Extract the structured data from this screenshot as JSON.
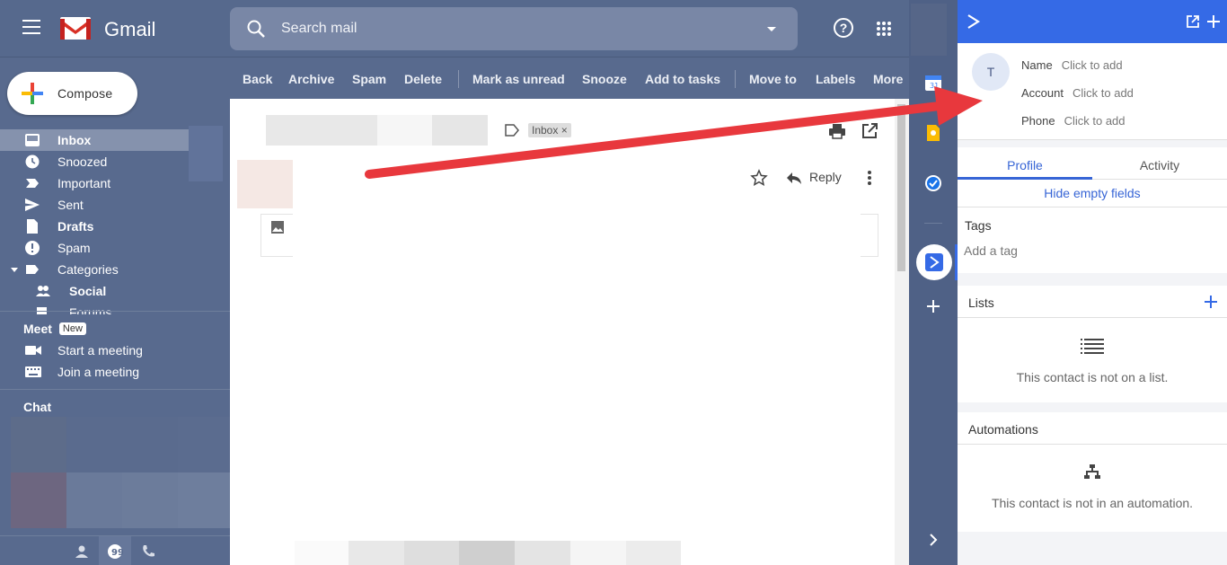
{
  "header": {
    "brand": "Gmail",
    "search_placeholder": "Search mail"
  },
  "compose": {
    "label": "Compose"
  },
  "nav": [
    {
      "label": "Inbox",
      "icon": "inbox-icon",
      "active": true,
      "bold": true
    },
    {
      "label": "Snoozed",
      "icon": "clock-icon"
    },
    {
      "label": "Important",
      "icon": "important-icon"
    },
    {
      "label": "Sent",
      "icon": "send-icon"
    },
    {
      "label": "Drafts",
      "icon": "draft-icon",
      "bold": true
    },
    {
      "label": "Spam",
      "icon": "spam-icon"
    },
    {
      "label": "Categories",
      "icon": "label-icon"
    },
    {
      "label": "Social",
      "icon": "people-icon",
      "bold": true,
      "sub": true
    },
    {
      "label": "Forums",
      "icon": "forum-icon",
      "sub": true
    }
  ],
  "meet": {
    "title": "Meet",
    "badge": "New",
    "items": [
      {
        "label": "Start a meeting",
        "icon": "video-icon"
      },
      {
        "label": "Join a meeting",
        "icon": "keyboard-icon"
      }
    ]
  },
  "chat": {
    "title": "Chat"
  },
  "toolbar": [
    "Back",
    "Archive",
    "Spam",
    "Delete",
    "Mark as unread",
    "Snooze",
    "Add to tasks",
    "Move to",
    "Labels",
    "More"
  ],
  "email": {
    "label_tag": "Inbox",
    "reply_label": "Reply"
  },
  "contact_panel": {
    "avatar_initial": "T",
    "fields": [
      {
        "key": "Name",
        "value": "Click to add"
      },
      {
        "key": "Account",
        "value": "Click to add"
      },
      {
        "key": "Phone",
        "value": "Click to add"
      }
    ],
    "tabs": [
      "Profile",
      "Activity"
    ],
    "active_tab": "Profile",
    "hide_empty": "Hide empty fields",
    "tags_title": "Tags",
    "tags_placeholder": "Add a tag",
    "lists_title": "Lists",
    "lists_empty": "This contact is not on a list.",
    "automations_title": "Automations",
    "automations_empty": "This contact is not in an automation."
  },
  "colors": {
    "gmail_theme": "#56698d",
    "panel_accent": "#356ae6",
    "annotation_arrow": "#e8383d"
  }
}
